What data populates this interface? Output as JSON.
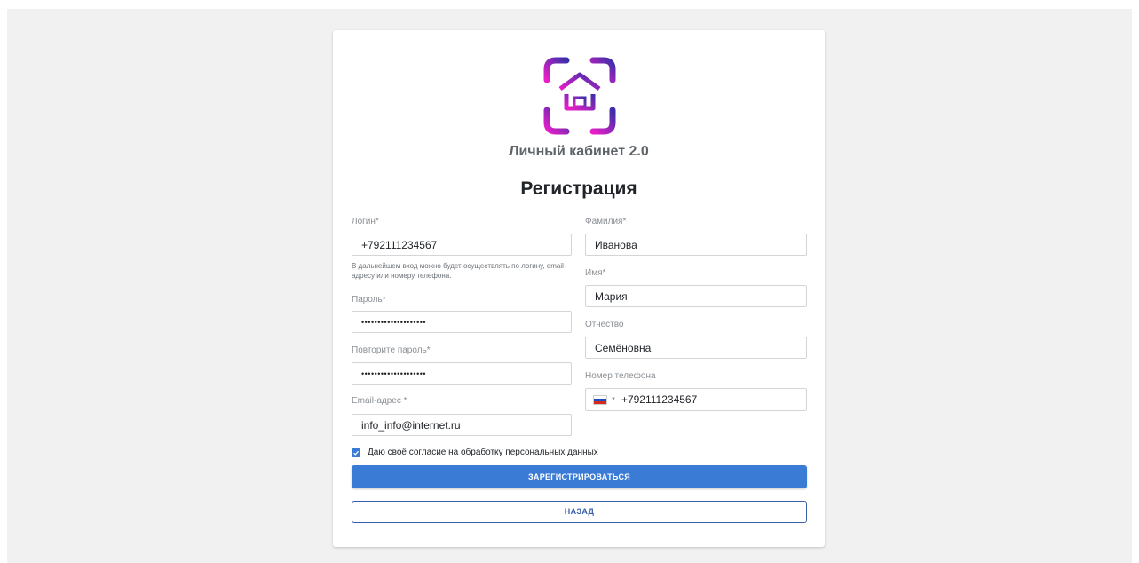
{
  "app": {
    "title": "Личный кабинет 2.0"
  },
  "page": {
    "title": "Регистрация"
  },
  "form": {
    "login": {
      "label": "Логин*",
      "value": "+792111234567"
    },
    "login_hint": "В дальнейшем вход можно будет осуществлять по логину, email-адресу или номеру телефона.",
    "password": {
      "label": "Пароль*",
      "value": "••••••••••••••••••••"
    },
    "password_repeat": {
      "label": "Повторите пароль*",
      "value": "••••••••••••••••••••"
    },
    "email": {
      "label": "Email-адрес *",
      "value": "info_info@internet.ru"
    },
    "last_name": {
      "label": "Фамилия*",
      "value": "Иванова"
    },
    "first_name": {
      "label": "Имя*",
      "value": "Мария"
    },
    "middle_name": {
      "label": "Отчество",
      "value": "Семёновна"
    },
    "phone": {
      "label": "Номер телефона",
      "value": "+792111234567",
      "country_icon": "russia-flag-icon"
    },
    "consent": {
      "label": "Даю своё согласие на обработку персональных данных",
      "checked": true
    }
  },
  "buttons": {
    "register": "ЗАРЕГИСТРИРОВАТЬСЯ",
    "back": "НАЗАД"
  },
  "colors": {
    "primary": "#3a7bd5",
    "logo_gradient_start": "#e91ec9",
    "logo_gradient_end": "#3b2fa8",
    "background": "#f1f1f1"
  }
}
